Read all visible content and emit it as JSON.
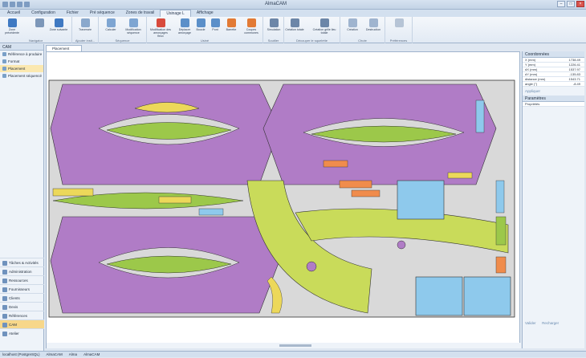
{
  "window": {
    "title": "AlmaCAM"
  },
  "tabs": [
    "Accueil",
    "Configuration",
    "Fichier",
    "Pré séquence",
    "Zones de travail",
    "Usinage L",
    "Affichage"
  ],
  "active_tab": 5,
  "ribbon": {
    "groups": [
      {
        "label": "Navigator",
        "buttons": [
          "Zone précédente",
          "Zone suivante"
        ]
      },
      {
        "label": "Ajouter insti...",
        "buttons": [
          "Traversée"
        ]
      },
      {
        "label": "Séquence",
        "buttons": [
          "Calculer",
          "Modification séquence"
        ]
      },
      {
        "label": "Usiné",
        "buttons": [
          "Modification des amorçages fleux",
          "Déplacer amorçage",
          "Boucle",
          "Pont",
          "Barrette",
          "Coupes communes"
        ]
      },
      {
        "label": "Soutiler",
        "buttons": [
          "Simulation"
        ]
      },
      {
        "label": "Découper le squelette",
        "buttons": [
          "Création totale",
          "Création grille lieu totale"
        ]
      },
      {
        "label": "Chute",
        "buttons": [
          "Création",
          "Destruction"
        ]
      },
      {
        "label": "Préférences",
        "buttons": []
      }
    ]
  },
  "left_panel": {
    "header": "CAM",
    "items": [
      "Référence à produire",
      "Format",
      "Placement",
      "Placement séquencé"
    ],
    "selected_item": 2,
    "nav": [
      "Tâches & Activités",
      "Administration",
      "Ressources",
      "Fournisseurs",
      "Clients",
      "Devis",
      "Références",
      "CAM",
      "Atelier"
    ],
    "selected_nav": 7
  },
  "doc_tab": "Placement",
  "right_panel": {
    "coords_header": "Coordonnées",
    "coords": [
      {
        "k": "X (mm)",
        "v": "1738.49"
      },
      {
        "k": "Y (mm)",
        "v": "1226.41"
      },
      {
        "k": "dX (mm)",
        "v": "1537.97"
      },
      {
        "k": "dY (mm)",
        "v": "-135.83"
      },
      {
        "k": "distance (mm)",
        "v": "1543.71"
      },
      {
        "k": "angle (°)",
        "v": "-8.49"
      }
    ],
    "coords_link": "Appliquer",
    "params_header": "Paramètres",
    "params_item": "Propriétés",
    "bottom_links": [
      "Valider",
      "Recharger"
    ]
  },
  "status": [
    "localhost (PostgreSQL)",
    "AlmaCAM",
    "Alma",
    "AlmaCAM"
  ],
  "colors": {
    "purple": "#b07cc6",
    "green": "#9cc84a",
    "lime": "#c9db5a",
    "blue": "#8ec9ec",
    "grey": "#d9d9d9",
    "orange": "#f08c4c",
    "yellow": "#ecd85a"
  }
}
